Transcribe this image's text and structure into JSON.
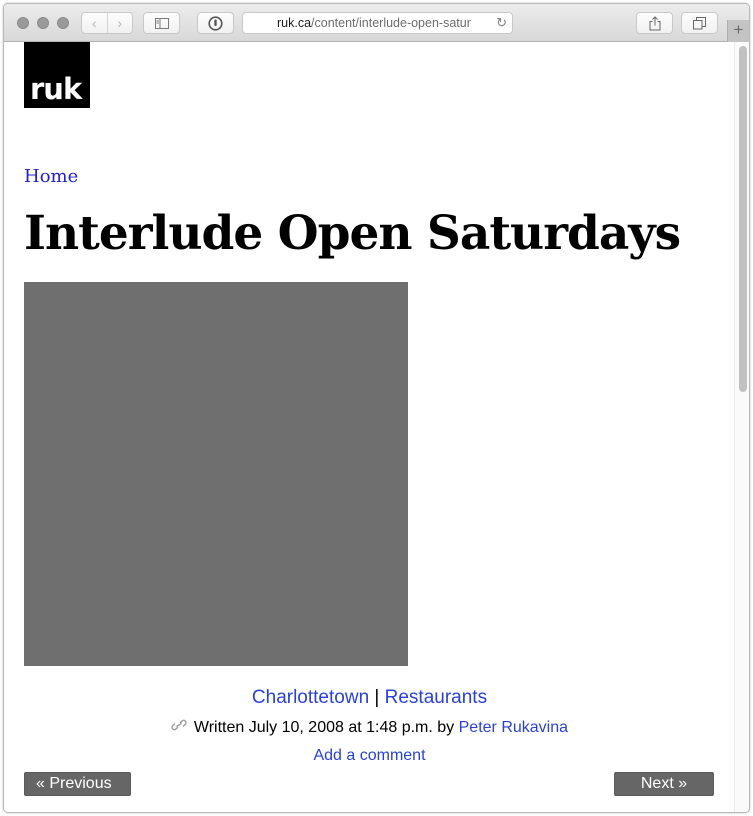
{
  "browser": {
    "url_domain": "ruk.ca",
    "url_path": "/content/interlude-open-satur",
    "back_icon": "‹",
    "forward_icon": "›",
    "reload_icon": "↻",
    "new_tab_icon": "+"
  },
  "site": {
    "logo_text": "ruk"
  },
  "page": {
    "breadcrumb": "Home",
    "title": "Interlude Open Saturdays",
    "tags": [
      "Charlottetown",
      "Restaurants"
    ],
    "tag_separator": "|",
    "meta": {
      "link_icon": "🔗",
      "written_prefix": "Written July 10, 2008 at 1:48 p.m. by",
      "author": "Peter Rukavina"
    },
    "comment_link": "Add a comment",
    "pager": {
      "previous": "« Previous",
      "next": "Next »"
    }
  },
  "colors": {
    "link": "#2a41d8",
    "photo_placeholder": "#6f6f6f",
    "pager_button": "#666666"
  }
}
